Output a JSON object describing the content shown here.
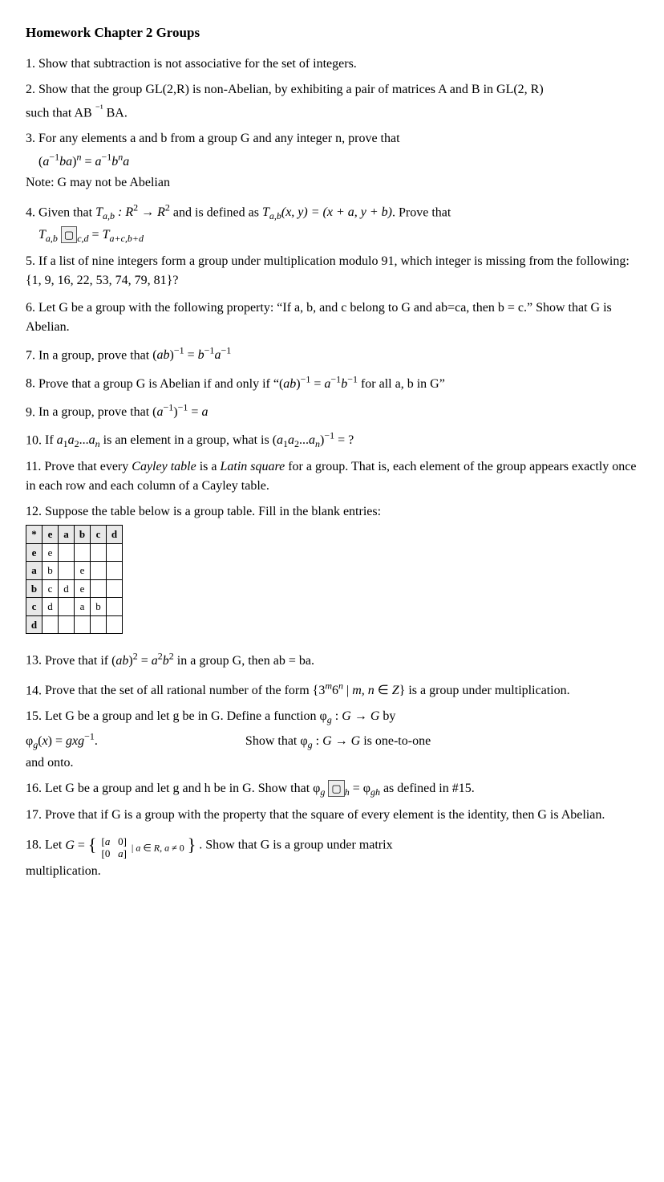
{
  "title": "Homework Chapter 2 Groups",
  "problems": [
    {
      "id": "p1",
      "number": "1.",
      "text": "Show that subtraction is not associative for the set of integers."
    },
    {
      "id": "p2",
      "number": "2.",
      "text": "Show that the group GL(2,R) is non-Abelian, by exhibiting a pair of matrices A and B in GL(2, R)"
    },
    {
      "id": "p2b",
      "text": "such that AB"
    },
    {
      "id": "p3",
      "number": "3.",
      "text": "For any elements a and b from a group G and any integer n, prove that"
    },
    {
      "id": "p3b",
      "text": "Note: G may not be Abelian"
    },
    {
      "id": "p4",
      "number": "4.",
      "text": "Given that"
    },
    {
      "id": "p4b",
      "text": "and is defined as"
    },
    {
      "id": "p4c",
      "text": "Prove that"
    },
    {
      "id": "p5",
      "number": "5.",
      "text": "If a list of nine integers form a group under multiplication modulo 91, which integer is missing from the following: {1, 9, 16, 22, 53, 74, 79, 81}?"
    },
    {
      "id": "p6",
      "number": "6.",
      "text": "Let G be a group with the following property: “If a, b, and c belong to G and ab=ca, then b = c.” Show that G is Abelian."
    },
    {
      "id": "p7",
      "number": "7.",
      "text": "In a group, prove that"
    },
    {
      "id": "p8",
      "number": "8.",
      "text": "Prove that a group G is Abelian if and only if “"
    },
    {
      "id": "p8b",
      "text": "for all a, b in G”"
    },
    {
      "id": "p9",
      "number": "9.",
      "text": "In a group, prove that"
    },
    {
      "id": "p10",
      "number": "10.",
      "text": "If"
    },
    {
      "id": "p10b",
      "text": "is an element in a group, what is"
    },
    {
      "id": "p11",
      "number": "11.",
      "text": "Prove that every"
    },
    {
      "id": "p11b",
      "text": "is a"
    },
    {
      "id": "p11c",
      "text": "for a group. That is, each element of the group appears exactly once in each row and each column of a Cayley table."
    },
    {
      "id": "p12",
      "number": "12.",
      "text": "Suppose the table below is a group table. Fill in the blank entries:"
    },
    {
      "id": "p13",
      "number": "13.",
      "text": "Prove that if"
    },
    {
      "id": "p13b",
      "text": "in a group G, then ab = ba."
    },
    {
      "id": "p14",
      "number": "14.",
      "text": "Prove that the set of all rational number of the form"
    },
    {
      "id": "p14b",
      "text": "is a group under multiplication."
    },
    {
      "id": "p15",
      "number": "15.",
      "text": "Let G be a group and let g be in G. Define a function"
    },
    {
      "id": "p15b",
      "text": "by"
    },
    {
      "id": "p15c",
      "text": "Show that"
    },
    {
      "id": "p15d",
      "text": "is one-to-one and onto."
    },
    {
      "id": "p16",
      "number": "16.",
      "text": "Let G be a group and let g and h be in G. Show that"
    },
    {
      "id": "p16b",
      "text": "as defined in #15."
    },
    {
      "id": "p17",
      "number": "17.",
      "text": "Prove that if G is a group with the property that the square of every element is the identity, then G is Abelian."
    },
    {
      "id": "p18",
      "number": "18.",
      "text": "Let"
    },
    {
      "id": "p18b",
      "text": ". Show that G is a group under matrix multiplication."
    }
  ],
  "cayley": {
    "headers": [
      "*",
      "e",
      "a",
      "b",
      "c",
      "d"
    ],
    "rows": [
      [
        "e",
        "e",
        "",
        "",
        "",
        ""
      ],
      [
        "a",
        "b",
        "",
        "e",
        "",
        ""
      ],
      [
        "b",
        "c",
        "d",
        "e",
        "",
        ""
      ],
      [
        "c",
        "d",
        "",
        "a",
        "b",
        ""
      ],
      [
        "d",
        "",
        "",
        "",
        "",
        ""
      ]
    ]
  }
}
